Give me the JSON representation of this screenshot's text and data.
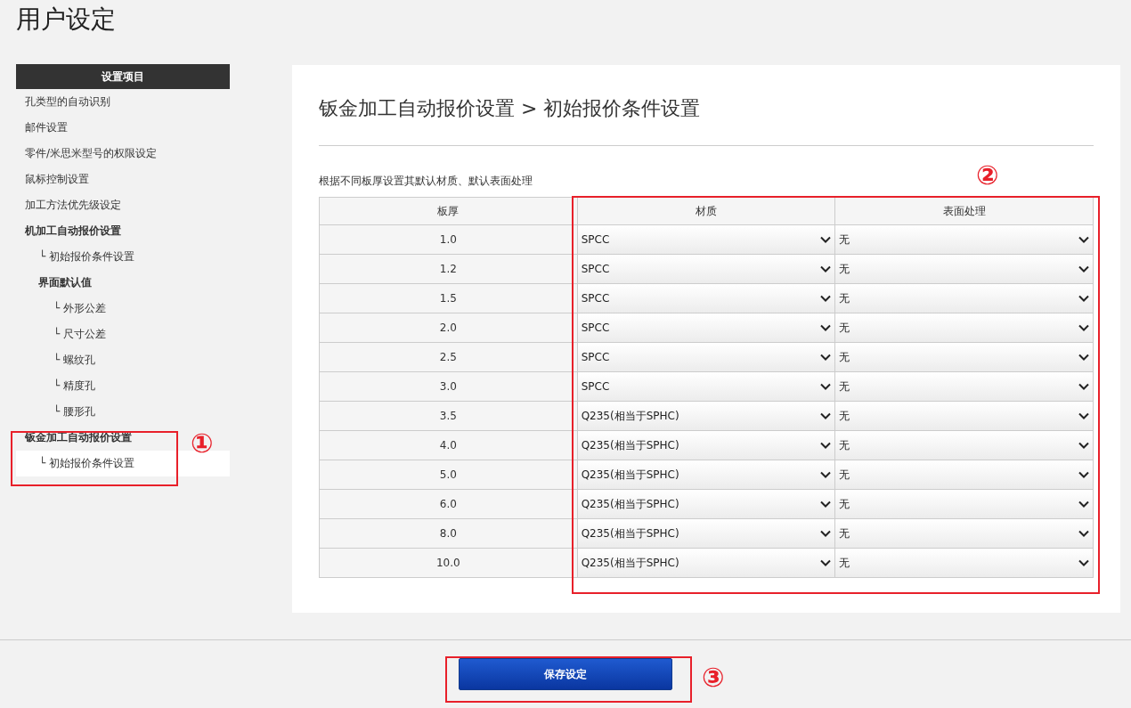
{
  "page_title": "用户设定",
  "sidebar": {
    "header": "设置项目",
    "items": [
      {
        "label": "孔类型的自动识别",
        "kind": "link",
        "selected": false
      },
      {
        "label": "邮件设置",
        "kind": "link",
        "selected": false
      },
      {
        "label": "零件/米思米型号的权限设定",
        "kind": "link",
        "selected": false
      },
      {
        "label": "鼠标控制设置",
        "kind": "link",
        "selected": false
      },
      {
        "label": "加工方法优先级设定",
        "kind": "link",
        "selected": false
      },
      {
        "label": "机加工自动报价设置",
        "kind": "group",
        "selected": false,
        "children": [
          {
            "label": "└ 初始报价条件设置",
            "kind": "link",
            "selected": false
          },
          {
            "label": "界面默认值",
            "kind": "group",
            "selected": false,
            "children": [
              {
                "label": "└ 外形公差",
                "kind": "link",
                "selected": false
              },
              {
                "label": "└ 尺寸公差",
                "kind": "link",
                "selected": false
              },
              {
                "label": "└ 螺纹孔",
                "kind": "link",
                "selected": false
              },
              {
                "label": "└ 精度孔",
                "kind": "link",
                "selected": false
              },
              {
                "label": "└ 腰形孔",
                "kind": "link",
                "selected": false
              }
            ]
          }
        ]
      },
      {
        "label": "钣金加工自动报价设置",
        "kind": "group",
        "selected": false,
        "children": [
          {
            "label": "└ 初始报价条件设置",
            "kind": "link",
            "selected": true
          }
        ]
      }
    ]
  },
  "main": {
    "heading": "钣金加工自动报价设置 > 初始报价条件设置",
    "description": "根据不同板厚设置其默认材质、默认表面处理",
    "table": {
      "columns": [
        "板厚",
        "材质",
        "表面处理"
      ],
      "rows": [
        {
          "thickness": "1.0",
          "material": "SPCC",
          "surface": "无"
        },
        {
          "thickness": "1.2",
          "material": "SPCC",
          "surface": "无"
        },
        {
          "thickness": "1.5",
          "material": "SPCC",
          "surface": "无"
        },
        {
          "thickness": "2.0",
          "material": "SPCC",
          "surface": "无"
        },
        {
          "thickness": "2.5",
          "material": "SPCC",
          "surface": "无"
        },
        {
          "thickness": "3.0",
          "material": "SPCC",
          "surface": "无"
        },
        {
          "thickness": "3.5",
          "material": "Q235(相当于SPHC)",
          "surface": "无"
        },
        {
          "thickness": "4.0",
          "material": "Q235(相当于SPHC)",
          "surface": "无"
        },
        {
          "thickness": "5.0",
          "material": "Q235(相当于SPHC)",
          "surface": "无"
        },
        {
          "thickness": "6.0",
          "material": "Q235(相当于SPHC)",
          "surface": "无"
        },
        {
          "thickness": "8.0",
          "material": "Q235(相当于SPHC)",
          "surface": "无"
        },
        {
          "thickness": "10.0",
          "material": "Q235(相当于SPHC)",
          "surface": "无"
        }
      ]
    }
  },
  "save_button": "保存设定",
  "annotations": [
    "①",
    "②",
    "③"
  ]
}
